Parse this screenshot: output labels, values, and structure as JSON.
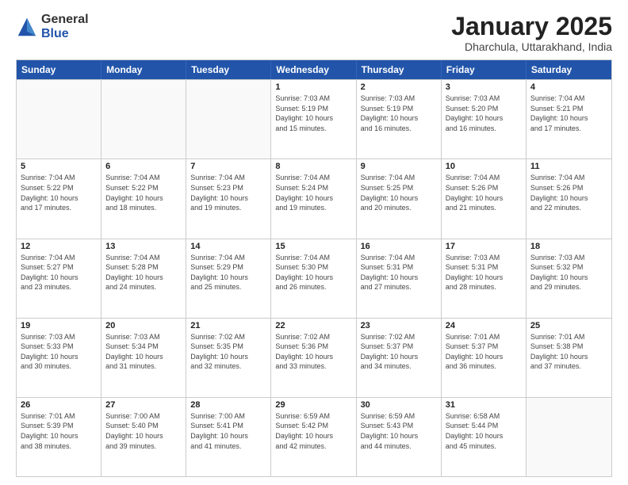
{
  "logo": {
    "general": "General",
    "blue": "Blue"
  },
  "title": "January 2025",
  "location": "Dharchula, Uttarakhand, India",
  "days": [
    "Sunday",
    "Monday",
    "Tuesday",
    "Wednesday",
    "Thursday",
    "Friday",
    "Saturday"
  ],
  "weeks": [
    [
      {
        "day": "",
        "lines": []
      },
      {
        "day": "",
        "lines": []
      },
      {
        "day": "",
        "lines": []
      },
      {
        "day": "1",
        "lines": [
          "Sunrise: 7:03 AM",
          "Sunset: 5:19 PM",
          "Daylight: 10 hours",
          "and 15 minutes."
        ]
      },
      {
        "day": "2",
        "lines": [
          "Sunrise: 7:03 AM",
          "Sunset: 5:19 PM",
          "Daylight: 10 hours",
          "and 16 minutes."
        ]
      },
      {
        "day": "3",
        "lines": [
          "Sunrise: 7:03 AM",
          "Sunset: 5:20 PM",
          "Daylight: 10 hours",
          "and 16 minutes."
        ]
      },
      {
        "day": "4",
        "lines": [
          "Sunrise: 7:04 AM",
          "Sunset: 5:21 PM",
          "Daylight: 10 hours",
          "and 17 minutes."
        ]
      }
    ],
    [
      {
        "day": "5",
        "lines": [
          "Sunrise: 7:04 AM",
          "Sunset: 5:22 PM",
          "Daylight: 10 hours",
          "and 17 minutes."
        ]
      },
      {
        "day": "6",
        "lines": [
          "Sunrise: 7:04 AM",
          "Sunset: 5:22 PM",
          "Daylight: 10 hours",
          "and 18 minutes."
        ]
      },
      {
        "day": "7",
        "lines": [
          "Sunrise: 7:04 AM",
          "Sunset: 5:23 PM",
          "Daylight: 10 hours",
          "and 19 minutes."
        ]
      },
      {
        "day": "8",
        "lines": [
          "Sunrise: 7:04 AM",
          "Sunset: 5:24 PM",
          "Daylight: 10 hours",
          "and 19 minutes."
        ]
      },
      {
        "day": "9",
        "lines": [
          "Sunrise: 7:04 AM",
          "Sunset: 5:25 PM",
          "Daylight: 10 hours",
          "and 20 minutes."
        ]
      },
      {
        "day": "10",
        "lines": [
          "Sunrise: 7:04 AM",
          "Sunset: 5:26 PM",
          "Daylight: 10 hours",
          "and 21 minutes."
        ]
      },
      {
        "day": "11",
        "lines": [
          "Sunrise: 7:04 AM",
          "Sunset: 5:26 PM",
          "Daylight: 10 hours",
          "and 22 minutes."
        ]
      }
    ],
    [
      {
        "day": "12",
        "lines": [
          "Sunrise: 7:04 AM",
          "Sunset: 5:27 PM",
          "Daylight: 10 hours",
          "and 23 minutes."
        ]
      },
      {
        "day": "13",
        "lines": [
          "Sunrise: 7:04 AM",
          "Sunset: 5:28 PM",
          "Daylight: 10 hours",
          "and 24 minutes."
        ]
      },
      {
        "day": "14",
        "lines": [
          "Sunrise: 7:04 AM",
          "Sunset: 5:29 PM",
          "Daylight: 10 hours",
          "and 25 minutes."
        ]
      },
      {
        "day": "15",
        "lines": [
          "Sunrise: 7:04 AM",
          "Sunset: 5:30 PM",
          "Daylight: 10 hours",
          "and 26 minutes."
        ]
      },
      {
        "day": "16",
        "lines": [
          "Sunrise: 7:04 AM",
          "Sunset: 5:31 PM",
          "Daylight: 10 hours",
          "and 27 minutes."
        ]
      },
      {
        "day": "17",
        "lines": [
          "Sunrise: 7:03 AM",
          "Sunset: 5:31 PM",
          "Daylight: 10 hours",
          "and 28 minutes."
        ]
      },
      {
        "day": "18",
        "lines": [
          "Sunrise: 7:03 AM",
          "Sunset: 5:32 PM",
          "Daylight: 10 hours",
          "and 29 minutes."
        ]
      }
    ],
    [
      {
        "day": "19",
        "lines": [
          "Sunrise: 7:03 AM",
          "Sunset: 5:33 PM",
          "Daylight: 10 hours",
          "and 30 minutes."
        ]
      },
      {
        "day": "20",
        "lines": [
          "Sunrise: 7:03 AM",
          "Sunset: 5:34 PM",
          "Daylight: 10 hours",
          "and 31 minutes."
        ]
      },
      {
        "day": "21",
        "lines": [
          "Sunrise: 7:02 AM",
          "Sunset: 5:35 PM",
          "Daylight: 10 hours",
          "and 32 minutes."
        ]
      },
      {
        "day": "22",
        "lines": [
          "Sunrise: 7:02 AM",
          "Sunset: 5:36 PM",
          "Daylight: 10 hours",
          "and 33 minutes."
        ]
      },
      {
        "day": "23",
        "lines": [
          "Sunrise: 7:02 AM",
          "Sunset: 5:37 PM",
          "Daylight: 10 hours",
          "and 34 minutes."
        ]
      },
      {
        "day": "24",
        "lines": [
          "Sunrise: 7:01 AM",
          "Sunset: 5:37 PM",
          "Daylight: 10 hours",
          "and 36 minutes."
        ]
      },
      {
        "day": "25",
        "lines": [
          "Sunrise: 7:01 AM",
          "Sunset: 5:38 PM",
          "Daylight: 10 hours",
          "and 37 minutes."
        ]
      }
    ],
    [
      {
        "day": "26",
        "lines": [
          "Sunrise: 7:01 AM",
          "Sunset: 5:39 PM",
          "Daylight: 10 hours",
          "and 38 minutes."
        ]
      },
      {
        "day": "27",
        "lines": [
          "Sunrise: 7:00 AM",
          "Sunset: 5:40 PM",
          "Daylight: 10 hours",
          "and 39 minutes."
        ]
      },
      {
        "day": "28",
        "lines": [
          "Sunrise: 7:00 AM",
          "Sunset: 5:41 PM",
          "Daylight: 10 hours",
          "and 41 minutes."
        ]
      },
      {
        "day": "29",
        "lines": [
          "Sunrise: 6:59 AM",
          "Sunset: 5:42 PM",
          "Daylight: 10 hours",
          "and 42 minutes."
        ]
      },
      {
        "day": "30",
        "lines": [
          "Sunrise: 6:59 AM",
          "Sunset: 5:43 PM",
          "Daylight: 10 hours",
          "and 44 minutes."
        ]
      },
      {
        "day": "31",
        "lines": [
          "Sunrise: 6:58 AM",
          "Sunset: 5:44 PM",
          "Daylight: 10 hours",
          "and 45 minutes."
        ]
      },
      {
        "day": "",
        "lines": []
      }
    ]
  ]
}
